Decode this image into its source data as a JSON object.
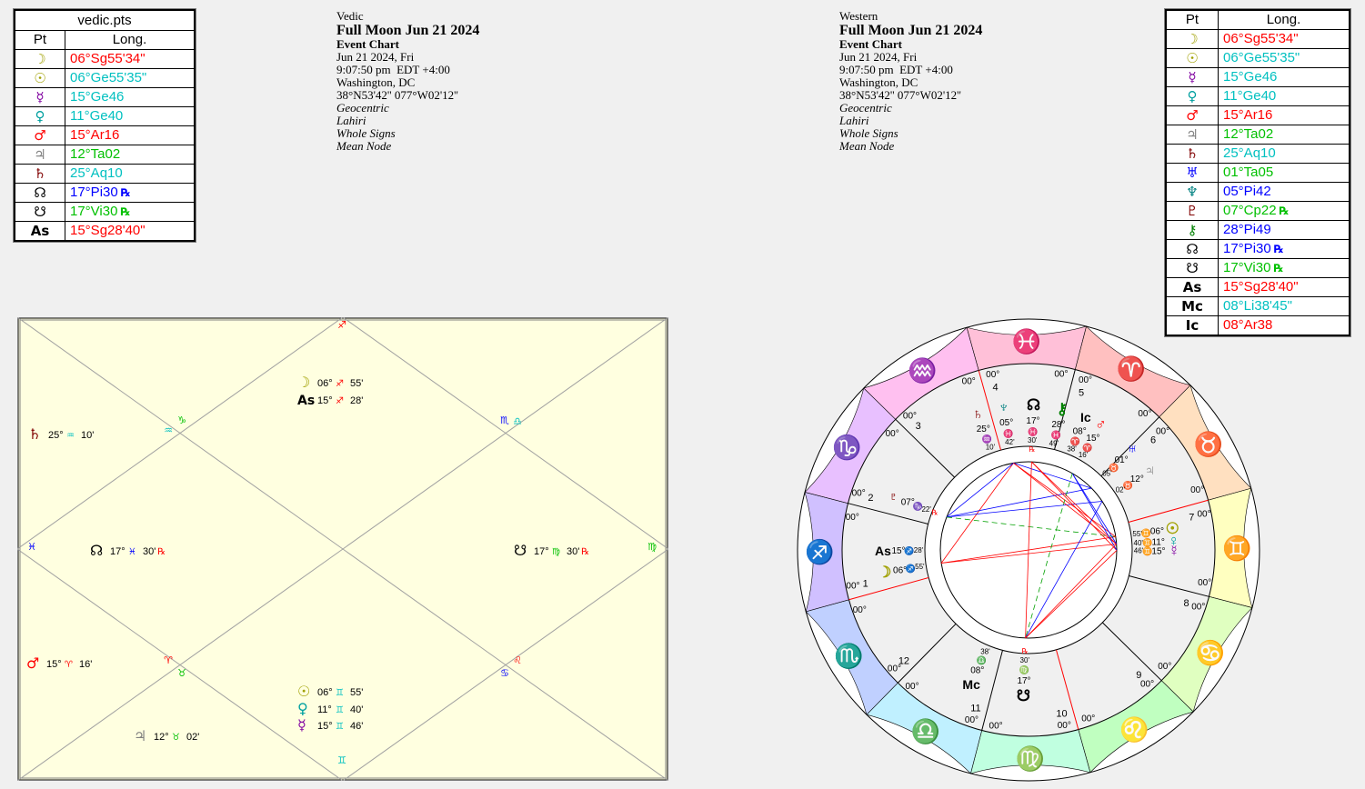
{
  "vedic_table": {
    "title": "vedic.pts",
    "col_pt": "Pt",
    "col_long": "Long.",
    "rows": [
      {
        "planet": "Moon",
        "glyph": "☽",
        "color": "#a0a000",
        "long": "06°Sg55'34\"",
        "long_color": "#ff0000",
        "rx": ""
      },
      {
        "planet": "Sun",
        "glyph": "☉",
        "color": "#a0a000",
        "long": "06°Ge55'35\"",
        "long_color": "#00c0c0",
        "rx": ""
      },
      {
        "planet": "Mercury",
        "glyph": "☿",
        "color": "#8000a0",
        "long": "15°Ge46",
        "long_color": "#00c0c0",
        "rx": ""
      },
      {
        "planet": "Venus",
        "glyph": "♀",
        "color": "#00a0a0",
        "long": "11°Ge40",
        "long_color": "#00c0c0",
        "rx": ""
      },
      {
        "planet": "Mars",
        "glyph": "♂",
        "color": "#ff0000",
        "long": "15°Ar16",
        "long_color": "#ff0000",
        "rx": ""
      },
      {
        "planet": "Jupiter",
        "glyph": "♃",
        "color": "#808080",
        "long": "12°Ta02",
        "long_color": "#00c000",
        "rx": ""
      },
      {
        "planet": "Saturn",
        "glyph": "♄",
        "color": "#800000",
        "long": "25°Aq10",
        "long_color": "#00c0c0",
        "rx": ""
      },
      {
        "planet": "North Node",
        "glyph": "☊",
        "color": "#000000",
        "long": "17°Pi30",
        "long_color": "#0000ff",
        "rx": "℞"
      },
      {
        "planet": "South Node",
        "glyph": "☋",
        "color": "#000000",
        "long": "17°Vi30",
        "long_color": "#00c000",
        "rx": "℞"
      },
      {
        "planet": "Ascendant",
        "glyph": "As",
        "color": "#000000",
        "long": "15°Sg28'40\"",
        "long_color": "#ff0000",
        "rx": ""
      }
    ]
  },
  "western_table": {
    "col_pt": "Pt",
    "col_long": "Long.",
    "rows": [
      {
        "planet": "Moon",
        "glyph": "☽",
        "color": "#a0a000",
        "long": "06°Sg55'34\"",
        "long_color": "#ff0000",
        "rx": ""
      },
      {
        "planet": "Sun",
        "glyph": "☉",
        "color": "#a0a000",
        "long": "06°Ge55'35\"",
        "long_color": "#00c0c0",
        "rx": ""
      },
      {
        "planet": "Mercury",
        "glyph": "☿",
        "color": "#8000a0",
        "long": "15°Ge46",
        "long_color": "#00c0c0",
        "rx": ""
      },
      {
        "planet": "Venus",
        "glyph": "♀",
        "color": "#00a0a0",
        "long": "11°Ge40",
        "long_color": "#00c0c0",
        "rx": ""
      },
      {
        "planet": "Mars",
        "glyph": "♂",
        "color": "#ff0000",
        "long": "15°Ar16",
        "long_color": "#ff0000",
        "rx": ""
      },
      {
        "planet": "Jupiter",
        "glyph": "♃",
        "color": "#808080",
        "long": "12°Ta02",
        "long_color": "#00c000",
        "rx": ""
      },
      {
        "planet": "Saturn",
        "glyph": "♄",
        "color": "#800000",
        "long": "25°Aq10",
        "long_color": "#00c0c0",
        "rx": ""
      },
      {
        "planet": "Uranus",
        "glyph": "♅",
        "color": "#0000ff",
        "long": "01°Ta05",
        "long_color": "#00c000",
        "rx": ""
      },
      {
        "planet": "Neptune",
        "glyph": "♆",
        "color": "#008080",
        "long": "05°Pi42",
        "long_color": "#0000ff",
        "rx": ""
      },
      {
        "planet": "Pluto",
        "glyph": "♇",
        "color": "#800000",
        "long": "07°Cp22",
        "long_color": "#00c000",
        "rx": "℞"
      },
      {
        "planet": "Chiron",
        "glyph": "⚷",
        "color": "#008000",
        "long": "28°Pi49",
        "long_color": "#0000ff",
        "rx": ""
      },
      {
        "planet": "North Node",
        "glyph": "☊",
        "color": "#000000",
        "long": "17°Pi30",
        "long_color": "#0000ff",
        "rx": "℞"
      },
      {
        "planet": "South Node",
        "glyph": "☋",
        "color": "#000000",
        "long": "17°Vi30",
        "long_color": "#00c000",
        "rx": "℞"
      },
      {
        "planet": "Ascendant",
        "glyph": "As",
        "color": "#000000",
        "long": "15°Sg28'40\"",
        "long_color": "#ff0000",
        "rx": ""
      },
      {
        "planet": "Midheaven",
        "glyph": "Mc",
        "color": "#000000",
        "long": "08°Li38'45\"",
        "long_color": "#00c0c0",
        "rx": ""
      },
      {
        "planet": "Imum Coeli",
        "glyph": "Ic",
        "color": "#000000",
        "long": "08°Ar38",
        "long_color": "#ff0000",
        "rx": ""
      }
    ]
  },
  "vedic_info": {
    "system": "Vedic",
    "title": "Full Moon Jun 21 2024",
    "chart_type": "Event Chart",
    "date": "Jun 21 2024, Fri",
    "time": "9:07:50 pm  EDT +4:00",
    "place": "Washington, DC",
    "coords": "38°N53'42'' 077°W02'12''",
    "view": "Geocentric",
    "zodiac": "Lahiri",
    "houses": "Whole Signs",
    "node": "Mean Node"
  },
  "western_info": {
    "system": "Western",
    "title": "Full Moon Jun 21 2024",
    "chart_type": "Event Chart",
    "date": "Jun 21 2024, Fri",
    "time": "9:07:50 pm  EDT +4:00",
    "place": "Washington, DC",
    "coords": "38°N53'42'' 077°W02'12''",
    "view": "Geocentric",
    "zodiac": "Lahiri",
    "houses": "Whole Signs",
    "node": "Mean Node"
  },
  "vedic_chart": {
    "background": "#ffffe0",
    "houses": [
      {
        "house": 1,
        "sign_glyph": "♐",
        "sign_color": "#ff0000",
        "planets": [
          {
            "glyph": "☽",
            "color": "#a0a000",
            "deg": "06°",
            "sign": "♐",
            "sign_color": "#ff0000",
            "min": "55'",
            "rx": ""
          },
          {
            "glyph": "As",
            "color": "#000000",
            "deg": "15°",
            "sign": "♐",
            "sign_color": "#ff0000",
            "min": "28'",
            "rx": ""
          }
        ]
      },
      {
        "house": 2,
        "sign_glyph": "♑",
        "sign_color": "#00c000",
        "planets": []
      },
      {
        "house": 3,
        "sign_glyph": "♒",
        "sign_color": "#00c0c0",
        "planets": [
          {
            "glyph": "♄",
            "color": "#800000",
            "deg": "25°",
            "sign": "♒",
            "sign_color": "#00c0c0",
            "min": "10'",
            "rx": ""
          }
        ]
      },
      {
        "house": 4,
        "sign_glyph": "♓",
        "sign_color": "#0000ff",
        "planets": [
          {
            "glyph": "☊",
            "color": "#000000",
            "deg": "17°",
            "sign": "♓",
            "sign_color": "#0000ff",
            "min": "30'",
            "rx": "℞"
          }
        ]
      },
      {
        "house": 5,
        "sign_glyph": "♈",
        "sign_color": "#ff0000",
        "planets": [
          {
            "glyph": "♂",
            "color": "#ff0000",
            "deg": "15°",
            "sign": "♈",
            "sign_color": "#ff0000",
            "min": "16'",
            "rx": ""
          }
        ]
      },
      {
        "house": 6,
        "sign_glyph": "♉",
        "sign_color": "#00c000",
        "planets": [
          {
            "glyph": "♃",
            "color": "#808080",
            "deg": "12°",
            "sign": "♉",
            "sign_color": "#00c000",
            "min": "02'",
            "rx": ""
          }
        ]
      },
      {
        "house": 7,
        "sign_glyph": "♊",
        "sign_color": "#00c0c0",
        "planets": [
          {
            "glyph": "☉",
            "color": "#a0a000",
            "deg": "06°",
            "sign": "♊",
            "sign_color": "#00c0c0",
            "min": "55'",
            "rx": ""
          },
          {
            "glyph": "♀",
            "color": "#00a0a0",
            "deg": "11°",
            "sign": "♊",
            "sign_color": "#00c0c0",
            "min": "40'",
            "rx": ""
          },
          {
            "glyph": "☿",
            "color": "#8000a0",
            "deg": "15°",
            "sign": "♊",
            "sign_color": "#00c0c0",
            "min": "46'",
            "rx": ""
          }
        ]
      },
      {
        "house": 8,
        "sign_glyph": "♋",
        "sign_color": "#0000ff",
        "planets": []
      },
      {
        "house": 9,
        "sign_glyph": "♌",
        "sign_color": "#ff0000",
        "planets": []
      },
      {
        "house": 10,
        "sign_glyph": "♍",
        "sign_color": "#00c000",
        "planets": [
          {
            "glyph": "☋",
            "color": "#000000",
            "deg": "17°",
            "sign": "♍",
            "sign_color": "#00c000",
            "min": "30'",
            "rx": "℞"
          }
        ]
      },
      {
        "house": 11,
        "sign_glyph": "♎",
        "sign_color": "#00c0c0",
        "planets": []
      },
      {
        "house": 12,
        "sign_glyph": "♏",
        "sign_color": "#0000ff",
        "planets": []
      }
    ]
  },
  "wheel": {
    "zodiac_ring": [
      {
        "sign": "Gemini",
        "glyph": "♊",
        "band": "#ffffc0",
        "glyph_color": "#000000"
      },
      {
        "sign": "Cancer",
        "glyph": "♋",
        "band": "#e0ffc0",
        "glyph_color": "#000000"
      },
      {
        "sign": "Leo",
        "glyph": "♌",
        "band": "#c0ffc0",
        "glyph_color": "#000000"
      },
      {
        "sign": "Virgo",
        "glyph": "♍",
        "band": "#c0ffe0",
        "glyph_color": "#000000"
      },
      {
        "sign": "Libra",
        "glyph": "♎",
        "band": "#c0f0ff",
        "glyph_color": "#000000"
      },
      {
        "sign": "Scorpio",
        "glyph": "♏",
        "band": "#c0d0ff",
        "glyph_color": "#000000"
      },
      {
        "sign": "Sagittarius",
        "glyph": "♐",
        "band": "#d0c0ff",
        "glyph_color": "#000000"
      },
      {
        "sign": "Capricorn",
        "glyph": "♑",
        "band": "#e8c0ff",
        "glyph_color": "#000000"
      },
      {
        "sign": "Aquarius",
        "glyph": "♒",
        "band": "#ffc0f0",
        "glyph_color": "#000000"
      },
      {
        "sign": "Pisces",
        "glyph": "♓",
        "band": "#ffc0d8",
        "glyph_color": "#000000"
      },
      {
        "sign": "Aries",
        "glyph": "♈",
        "band": "#ffc0c0",
        "glyph_color": "#000000"
      },
      {
        "sign": "Taurus",
        "glyph": "♉",
        "band": "#ffe0c0",
        "glyph_color": "#000000"
      }
    ],
    "cusp_label": "00°",
    "house_numbers": [
      "1",
      "2",
      "3",
      "4",
      "5",
      "6",
      "7",
      "8",
      "9",
      "10",
      "11",
      "12"
    ],
    "planets": [
      {
        "name": "Moon",
        "glyph": "☽",
        "color": "#a0a000",
        "deg": "06°",
        "sign": "♐",
        "sign_color": "#ff0000",
        "min": "55'",
        "rx": "",
        "house": 1
      },
      {
        "name": "Ascendant",
        "glyph": "As",
        "color": "#000000",
        "deg": "15°",
        "sign": "♐",
        "sign_color": "#ff0000",
        "min": "28'",
        "rx": "",
        "house": 1
      },
      {
        "name": "Pluto",
        "glyph": "♇",
        "color": "#800000",
        "deg": "07°",
        "sign": "♑",
        "sign_color": "#00c000",
        "min": "22'",
        "rx": "℞",
        "house": 2
      },
      {
        "name": "Saturn",
        "glyph": "♄",
        "color": "#800000",
        "deg": "25°",
        "sign": "♒",
        "sign_color": "#00c0c0",
        "min": "10'",
        "rx": "",
        "house": 3
      },
      {
        "name": "Neptune",
        "glyph": "♆",
        "color": "#008080",
        "deg": "05°",
        "sign": "♓",
        "sign_color": "#0000ff",
        "min": "42'",
        "rx": "",
        "house": 4
      },
      {
        "name": "North Node",
        "glyph": "☊",
        "color": "#000000",
        "deg": "17°",
        "sign": "♓",
        "sign_color": "#0000ff",
        "min": "30'",
        "rx": "℞",
        "house": 4
      },
      {
        "name": "Chiron",
        "glyph": "⚷",
        "color": "#008000",
        "deg": "28°",
        "sign": "♓",
        "sign_color": "#0000ff",
        "min": "49'",
        "rx": "",
        "house": 4
      },
      {
        "name": "Imum Coeli",
        "glyph": "Ic",
        "color": "#000000",
        "deg": "08°",
        "sign": "♈",
        "sign_color": "#ff0000",
        "min": "38'",
        "rx": "",
        "house": 5
      },
      {
        "name": "Mars",
        "glyph": "♂",
        "color": "#ff0000",
        "deg": "15°",
        "sign": "♈",
        "sign_color": "#ff0000",
        "min": "16'",
        "rx": "",
        "house": 5
      },
      {
        "name": "Uranus",
        "glyph": "♅",
        "color": "#0000ff",
        "deg": "01°",
        "sign": "♉",
        "sign_color": "#00c000",
        "min": "05'",
        "rx": "",
        "house": 6
      },
      {
        "name": "Jupiter",
        "glyph": "♃",
        "color": "#808080",
        "deg": "12°",
        "sign": "♉",
        "sign_color": "#00c000",
        "min": "02'",
        "rx": "",
        "house": 6
      },
      {
        "name": "Sun",
        "glyph": "☉",
        "color": "#a0a000",
        "deg": "06°",
        "sign": "♊",
        "sign_color": "#00c0c0",
        "min": "55'",
        "rx": "",
        "house": 7
      },
      {
        "name": "Venus",
        "glyph": "♀",
        "color": "#00a0a0",
        "deg": "11°",
        "sign": "♊",
        "sign_color": "#00c0c0",
        "min": "40'",
        "rx": "",
        "house": 7
      },
      {
        "name": "Mercury",
        "glyph": "☿",
        "color": "#8000a0",
        "deg": "15°",
        "sign": "♊",
        "sign_color": "#00c0c0",
        "min": "46'",
        "rx": "",
        "house": 7
      },
      {
        "name": "Midheaven",
        "glyph": "Mc",
        "color": "#000000",
        "deg": "08°",
        "sign": "♎",
        "sign_color": "#00c0c0",
        "min": "38'",
        "rx": "",
        "house": 11
      },
      {
        "name": "South Node",
        "glyph": "☋",
        "color": "#000000",
        "deg": "17°",
        "sign": "♍",
        "sign_color": "#00c000",
        "min": "30'",
        "rx": "℞",
        "house": 10
      }
    ]
  }
}
